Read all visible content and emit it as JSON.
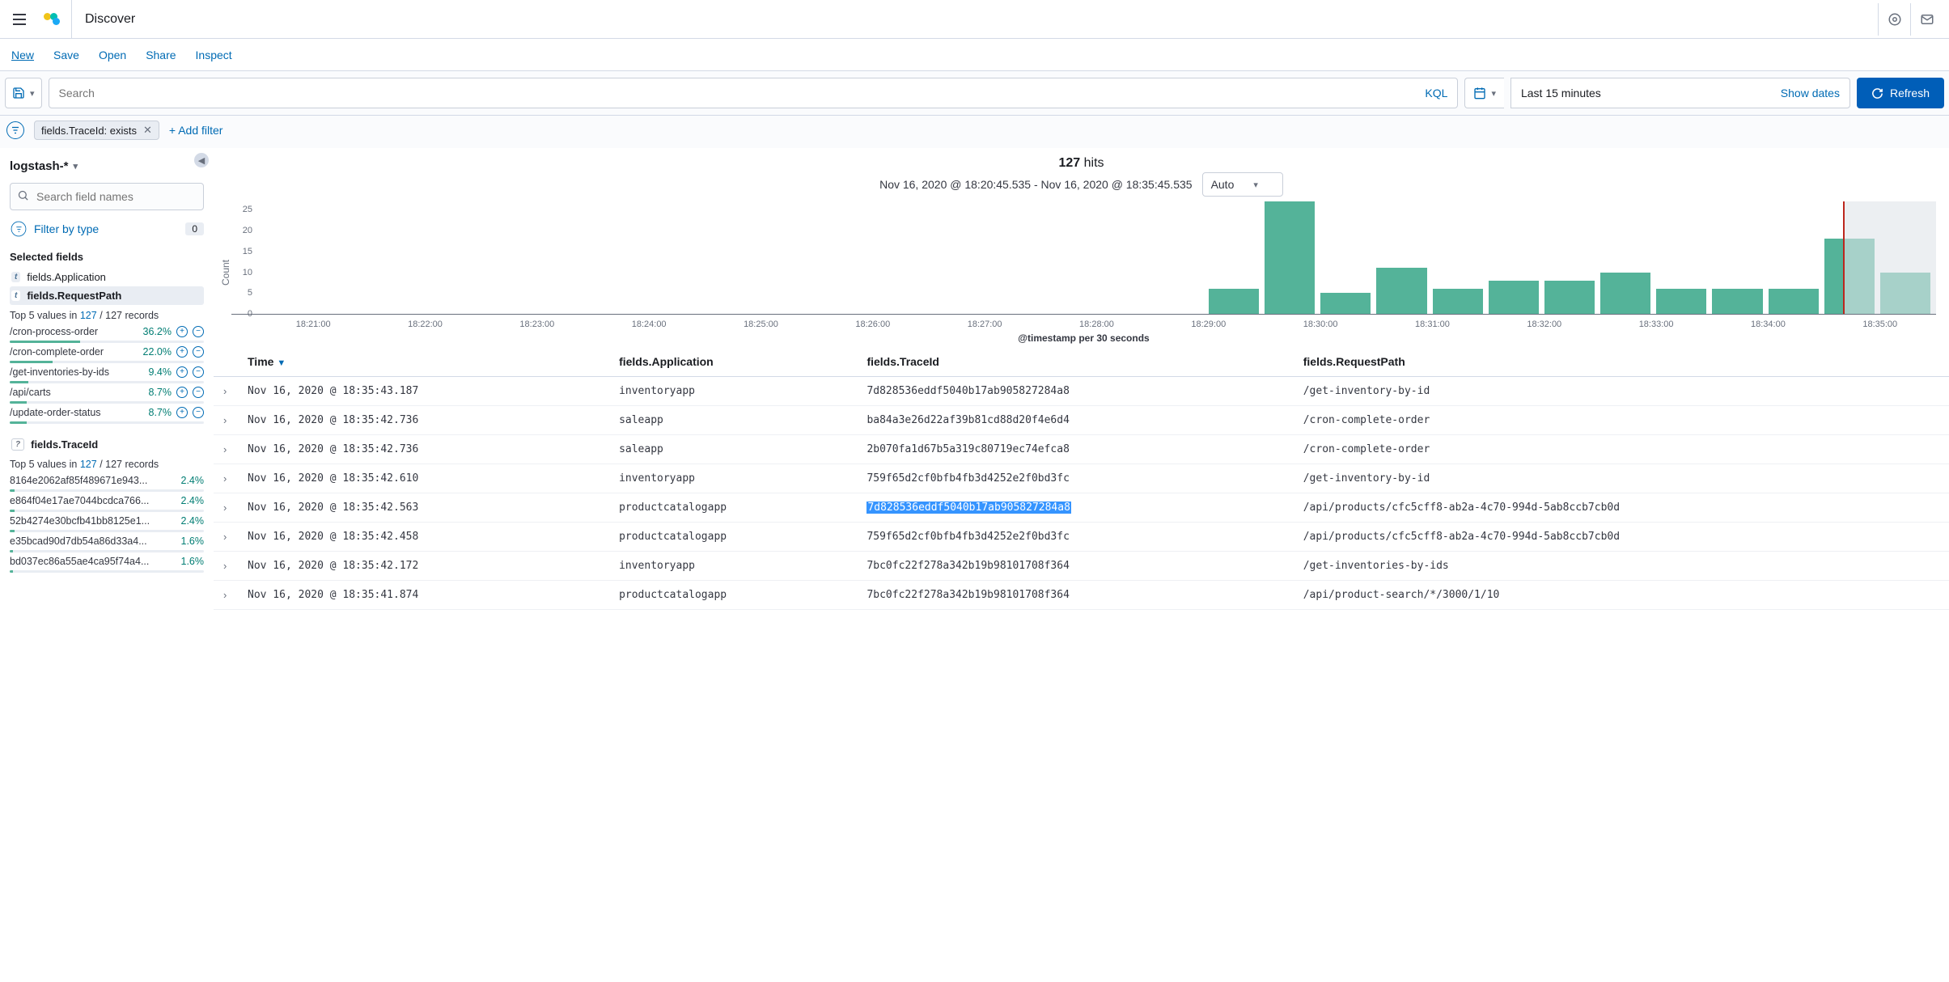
{
  "header": {
    "app_name": "Discover"
  },
  "nav": {
    "new": "New",
    "save": "Save",
    "open": "Open",
    "share": "Share",
    "inspect": "Inspect"
  },
  "query": {
    "search_placeholder": "Search",
    "kql_label": "KQL",
    "time_range": "Last 15 minutes",
    "show_dates": "Show dates",
    "refresh": "Refresh"
  },
  "filters": {
    "pill_text": "fields.TraceId: exists",
    "add_filter": "+ Add filter"
  },
  "sidebar": {
    "index_pattern": "logstash-*",
    "field_search_placeholder": "Search field names",
    "filter_by_type": "Filter by type",
    "filter_by_type_count": "0",
    "selected_title": "Selected fields",
    "fields": [
      {
        "name": "fields.Application",
        "type": "t"
      },
      {
        "name": "fields.RequestPath",
        "type": "t"
      }
    ],
    "request_path_stats": {
      "head_prefix": "Top 5 values in ",
      "head_link": "127",
      "head_suffix": " / 127 records",
      "rows": [
        {
          "val": "/cron-process-order",
          "pct": "36.2%",
          "bar": 36.2,
          "icons": true
        },
        {
          "val": "/cron-complete-order",
          "pct": "22.0%",
          "bar": 22.0,
          "icons": true
        },
        {
          "val": "/get-inventories-by-ids",
          "pct": "9.4%",
          "bar": 9.4,
          "icons": true
        },
        {
          "val": "/api/carts",
          "pct": "8.7%",
          "bar": 8.7,
          "icons": true
        },
        {
          "val": "/update-order-status",
          "pct": "8.7%",
          "bar": 8.7,
          "icons": true
        }
      ]
    },
    "traceid_field": {
      "name": "fields.TraceId",
      "type": "?"
    },
    "traceid_stats": {
      "head_prefix": "Top 5 values in ",
      "head_link": "127",
      "head_suffix": " / 127 records",
      "rows": [
        {
          "val": "8164e2062af85f489671e943...",
          "pct": "2.4%",
          "bar": 2.4
        },
        {
          "val": "e864f04e17ae7044bcdca766...",
          "pct": "2.4%",
          "bar": 2.4
        },
        {
          "val": "52b4274e30bcfb41bb8125e1...",
          "pct": "2.4%",
          "bar": 2.4
        },
        {
          "val": "e35bcad90d7db54a86d33a4...",
          "pct": "1.6%",
          "bar": 1.6
        },
        {
          "val": "bd037ec86a55ae4ca95f74a4...",
          "pct": "1.6%",
          "bar": 1.6
        }
      ]
    }
  },
  "results": {
    "hits_count": "127",
    "hits_label": " hits",
    "time_range_full": "Nov 16, 2020 @ 18:20:45.535 - Nov 16, 2020 @ 18:35:45.535",
    "interval": "Auto",
    "columns": [
      "Time",
      "fields.Application",
      "fields.TraceId",
      "fields.RequestPath"
    ],
    "rows": [
      {
        "time": "Nov 16, 2020 @ 18:35:43.187",
        "app": "inventoryapp",
        "trace": "7d828536eddf5040b17ab905827284a8",
        "path": "/get-inventory-by-id"
      },
      {
        "time": "Nov 16, 2020 @ 18:35:42.736",
        "app": "saleapp",
        "trace": "ba84a3e26d22af39b81cd88d20f4e6d4",
        "path": "/cron-complete-order"
      },
      {
        "time": "Nov 16, 2020 @ 18:35:42.736",
        "app": "saleapp",
        "trace": "2b070fa1d67b5a319c80719ec74efca8",
        "path": "/cron-complete-order"
      },
      {
        "time": "Nov 16, 2020 @ 18:35:42.610",
        "app": "inventoryapp",
        "trace": "759f65d2cf0bfb4fb3d4252e2f0bd3fc",
        "path": "/get-inventory-by-id"
      },
      {
        "time": "Nov 16, 2020 @ 18:35:42.563",
        "app": "productcatalogapp",
        "trace": "7d828536eddf5040b17ab905827284a8",
        "path": "/api/products/cfc5cff8-ab2a-4c70-994d-5ab8ccb7cb0d",
        "highlight_trace": true
      },
      {
        "time": "Nov 16, 2020 @ 18:35:42.458",
        "app": "productcatalogapp",
        "trace": "759f65d2cf0bfb4fb3d4252e2f0bd3fc",
        "path": "/api/products/cfc5cff8-ab2a-4c70-994d-5ab8ccb7cb0d"
      },
      {
        "time": "Nov 16, 2020 @ 18:35:42.172",
        "app": "inventoryapp",
        "trace": "7bc0fc22f278a342b19b98101708f364",
        "path": "/get-inventories-by-ids"
      },
      {
        "time": "Nov 16, 2020 @ 18:35:41.874",
        "app": "productcatalogapp",
        "trace": "7bc0fc22f278a342b19b98101708f364",
        "path": "/api/product-search/*/3000/1/10"
      }
    ]
  },
  "chart_data": {
    "type": "bar",
    "ylabel": "Count",
    "xlabel": "@timestamp per 30 seconds",
    "ylim": [
      0,
      27
    ],
    "yticks": [
      0,
      5,
      10,
      15,
      20,
      25
    ],
    "x_start": "18:21:00",
    "x_end": "18:35:30",
    "x_tick_labels": [
      "18:21:00",
      "18:22:00",
      "18:23:00",
      "18:24:00",
      "18:25:00",
      "18:26:00",
      "18:27:00",
      "18:28:00",
      "18:29:00",
      "18:30:00",
      "18:31:00",
      "18:32:00",
      "18:33:00",
      "18:34:00",
      "18:35:00"
    ],
    "bars": [
      {
        "x": "18:29:30",
        "v": 6
      },
      {
        "x": "18:30:00",
        "v": 27
      },
      {
        "x": "18:30:30",
        "v": 5
      },
      {
        "x": "18:31:00",
        "v": 11
      },
      {
        "x": "18:31:30",
        "v": 6
      },
      {
        "x": "18:32:00",
        "v": 8
      },
      {
        "x": "18:32:30",
        "v": 8
      },
      {
        "x": "18:33:00",
        "v": 10
      },
      {
        "x": "18:33:30",
        "v": 6
      },
      {
        "x": "18:34:00",
        "v": 6
      },
      {
        "x": "18:34:30",
        "v": 6
      },
      {
        "x": "18:35:00",
        "v": 18
      },
      {
        "x": "18:35:30",
        "v": 10
      }
    ],
    "red_marker_x": "18:35:10",
    "shade_from": "18:35:10"
  }
}
